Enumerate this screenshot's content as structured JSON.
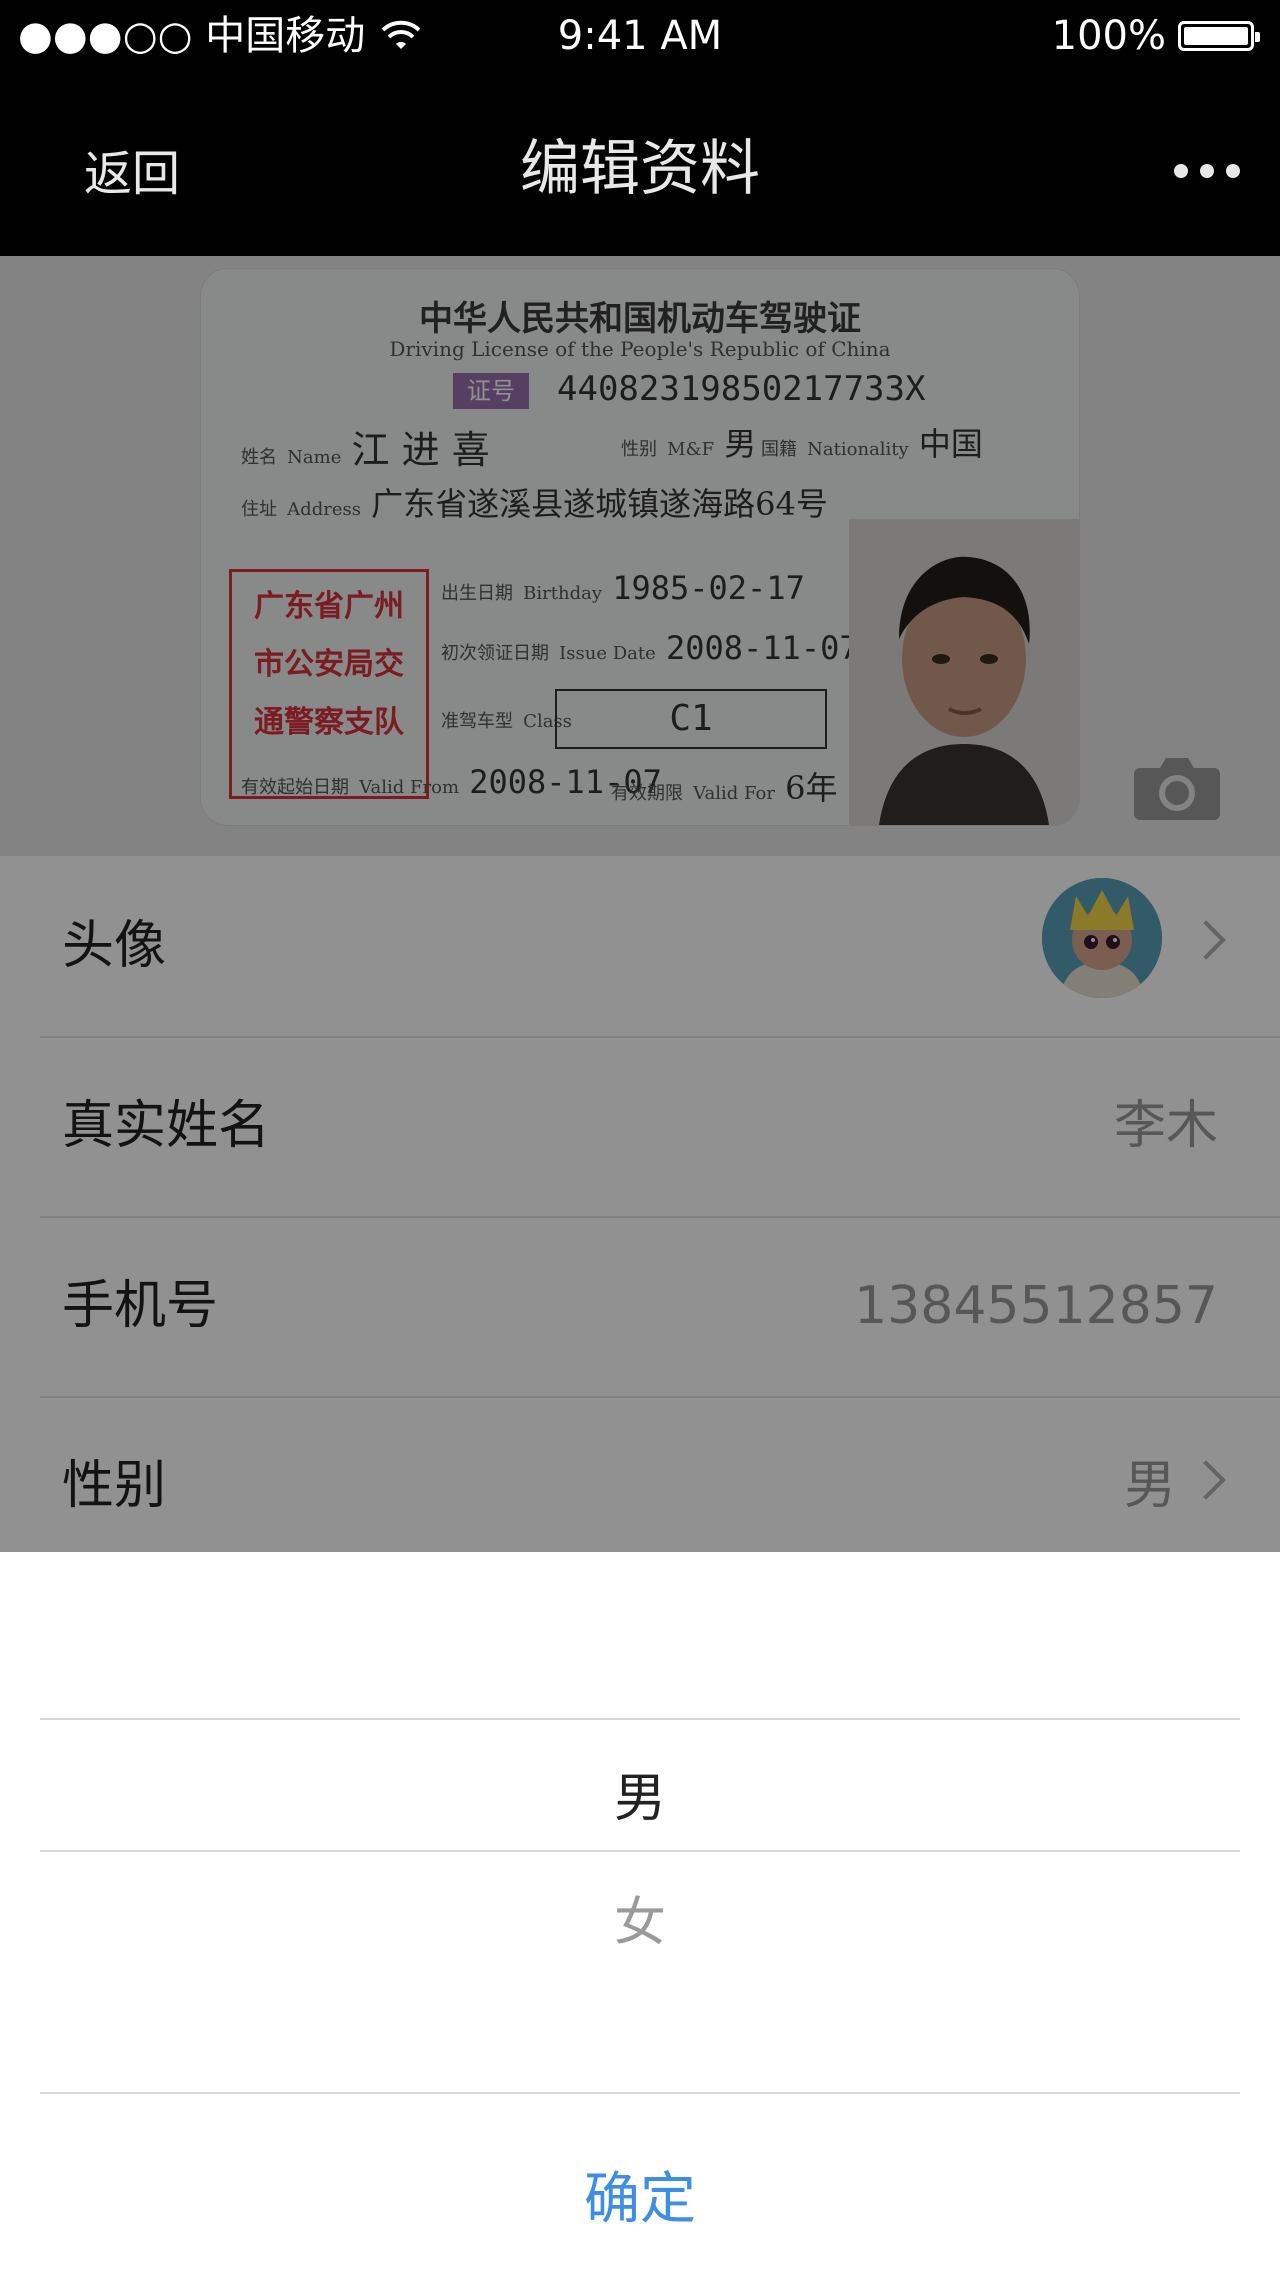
{
  "status_bar": {
    "carrier": "●●●○○ 中国移动",
    "time": "9:41 AM",
    "battery": "100%"
  },
  "nav": {
    "back": "返回",
    "title": "编辑资料",
    "more_icon": "more-dots-icon"
  },
  "license": {
    "title": "中华人民共和国机动车驾驶证",
    "subtitle": "Driving License of the People's Republic of China",
    "badge": "证号",
    "number": "44082319850217733X",
    "name_label": "姓名",
    "name_label_en": "Name",
    "name": "江 进 喜",
    "sex_label": "性别",
    "sex_label_en": "M&F",
    "sex": "男",
    "nationality_label": "国籍",
    "nationality_label_en": "Nationality",
    "nationality": "中国",
    "address_label": "住址",
    "address_label_en": "Address",
    "address": "广东省遂溪县遂城镇遂海路64号",
    "seal": [
      "广东省广州",
      "市公安局交",
      "通警察支队"
    ],
    "birthday_label": "出生日期",
    "birthday_label_en": "Birthday",
    "birthday": "1985-02-17",
    "issue_label": "初次领证日期",
    "issue_label_en": "Issue Date",
    "issue": "2008-11-07",
    "class_label": "准驾车型",
    "class_label_en": "Class",
    "class": "C1",
    "valid_from_label": "有效起始日期",
    "valid_from_label_en": "Valid From",
    "valid_from": "2008-11-07",
    "valid_for_label": "有效期限",
    "valid_for_label_en": "Valid For",
    "valid_for": "6年"
  },
  "rows": [
    {
      "label": "头像",
      "value": ""
    },
    {
      "label": "真实姓名",
      "value": "李木"
    },
    {
      "label": "手机号",
      "value": "13845512857"
    },
    {
      "label": "性别",
      "value": "男"
    }
  ],
  "picker": {
    "options": [
      "男",
      "女"
    ],
    "selected": "男",
    "confirm": "确定"
  },
  "colors": {
    "accent": "#3f8ee6",
    "overlay": "rgba(0,0,0,0.43)",
    "seal": "#d9303d"
  }
}
